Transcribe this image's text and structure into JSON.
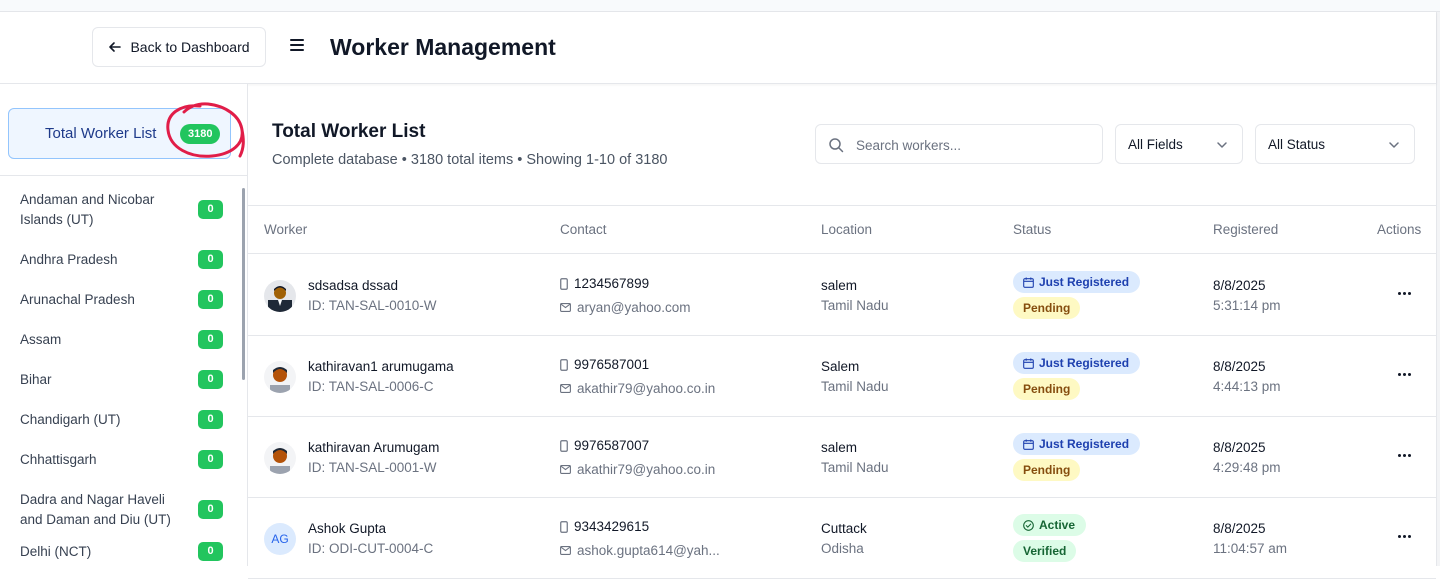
{
  "header": {
    "back_label": "Back to Dashboard",
    "title": "Worker Management"
  },
  "sidebar": {
    "total_label": "Total Worker List",
    "total_count": "3180",
    "states": [
      {
        "name": "Andaman and Nicobar Islands (UT)",
        "count": "0"
      },
      {
        "name": "Andhra Pradesh",
        "count": "0"
      },
      {
        "name": "Arunachal Pradesh",
        "count": "0"
      },
      {
        "name": "Assam",
        "count": "0"
      },
      {
        "name": "Bihar",
        "count": "0"
      },
      {
        "name": "Chandigarh (UT)",
        "count": "0"
      },
      {
        "name": "Chhattisgarh",
        "count": "0"
      },
      {
        "name": "Dadra and Nagar Haveli and Daman and Diu (UT)",
        "count": "0"
      },
      {
        "name": "Delhi (NCT)",
        "count": "0"
      }
    ]
  },
  "main": {
    "title": "Total Worker List",
    "subtitle": "Complete database • 3180 total items • Showing 1-10 of 3180",
    "search_placeholder": "Search workers...",
    "field_filter": "All Fields",
    "status_filter": "All Status"
  },
  "table": {
    "headers": [
      "Worker",
      "Contact",
      "Location",
      "Status",
      "Registered",
      "Actions"
    ],
    "rows": [
      {
        "name": "sdsadsa dssad",
        "id": "ID: TAN-SAL-0010-W",
        "avatar": "photo",
        "phone": "1234567899",
        "email": "aryan@yahoo.com",
        "city": "salem",
        "state": "Tamil Nadu",
        "status": "Just Registered",
        "status_icon": "calendar-icon",
        "sub_status": "Pending",
        "date": "8/8/2025",
        "time": "5:31:14 pm"
      },
      {
        "name": "kathiravan1 arumugama",
        "id": "ID: TAN-SAL-0006-C",
        "avatar": "photo",
        "phone": "9976587001",
        "email": "akathir79@yahoo.co.in",
        "city": "Salem",
        "state": "Tamil Nadu",
        "status": "Just Registered",
        "status_icon": "calendar-icon",
        "sub_status": "Pending",
        "date": "8/8/2025",
        "time": "4:44:13 pm"
      },
      {
        "name": "kathiravan Arumugam",
        "id": "ID: TAN-SAL-0001-W",
        "avatar": "photo",
        "phone": "9976587007",
        "email": "akathir79@yahoo.co.in",
        "city": "salem",
        "state": "Tamil Nadu",
        "status": "Just Registered",
        "status_icon": "calendar-icon",
        "sub_status": "Pending",
        "date": "8/8/2025",
        "time": "4:29:48 pm"
      },
      {
        "name": "Ashok Gupta",
        "id": "ID: ODI-CUT-0004-C",
        "avatar": "AG",
        "phone": "9343429615",
        "email": "ashok.gupta614@yah...",
        "city": "Cuttack",
        "state": "Odisha",
        "status": "Active",
        "status_icon": "check-circle-icon",
        "sub_status": "Verified",
        "date": "8/8/2025",
        "time": "11:04:57 am"
      }
    ]
  },
  "colors": {
    "accent_green": "#22c55e",
    "badge_blue_bg": "#dbeafe",
    "badge_yellow_bg": "#fef9c3",
    "annotation_red": "#e11d48"
  }
}
